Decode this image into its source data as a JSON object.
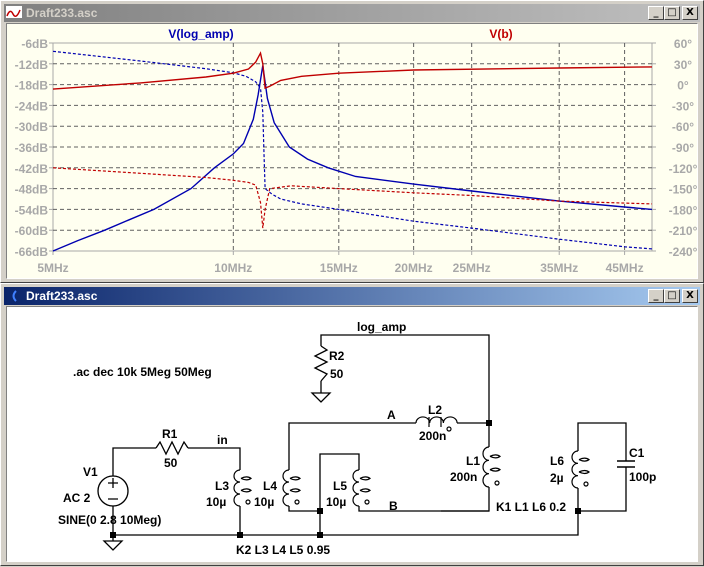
{
  "plot_window": {
    "title": "Draft233.asc",
    "buttons": {
      "minimize": "_",
      "maximize": "□",
      "close": "X"
    },
    "trace_labels": [
      {
        "label": "V(log_amp)",
        "color": "#0000b0"
      },
      {
        "label": "V(b)",
        "color": "#c00000"
      }
    ]
  },
  "chart_data": {
    "type": "line",
    "x_scale": "log",
    "xlim_mhz": [
      5,
      50
    ],
    "x_ticks": [
      "5MHz",
      "10MHz",
      "15MHz",
      "20MHz",
      "25MHz",
      "35MHz",
      "45MHz"
    ],
    "x_tick_values": [
      5,
      10,
      15,
      20,
      25,
      35,
      45
    ],
    "y_left": {
      "unit": "dB",
      "range": [
        -66,
        -6
      ],
      "ticks": [
        "-6dB",
        "-12dB",
        "-18dB",
        "-24dB",
        "-30dB",
        "-36dB",
        "-42dB",
        "-48dB",
        "-54dB",
        "-60dB",
        "-66dB"
      ]
    },
    "y_right": {
      "unit": "deg",
      "range": [
        -240,
        60
      ],
      "ticks": [
        "60°",
        "30°",
        "0°",
        "-30°",
        "-60°",
        "-90°",
        "-120°",
        "-150°",
        "-180°",
        "-210°",
        "-240°"
      ]
    },
    "grid": true,
    "series": [
      {
        "name": "V(log_amp) magnitude",
        "axis": "left",
        "style": "solid",
        "color": "#0000b0",
        "points": [
          [
            5,
            -66
          ],
          [
            5.5,
            -63
          ],
          [
            6.1,
            -60
          ],
          [
            6.7,
            -57
          ],
          [
            7.37,
            -54
          ],
          [
            8.5,
            -48
          ],
          [
            9.3,
            -42
          ],
          [
            10.0,
            -38
          ],
          [
            10.4,
            -35
          ],
          [
            10.8,
            -28
          ],
          [
            11.0,
            -21
          ],
          [
            11.2,
            -12.5
          ],
          [
            11.4,
            -22
          ],
          [
            11.7,
            -29
          ],
          [
            12.4,
            -36
          ],
          [
            13.3,
            -39.5
          ],
          [
            14.4,
            -42
          ],
          [
            16,
            -44.5
          ],
          [
            20,
            -46.7
          ],
          [
            25,
            -48.7
          ],
          [
            35,
            -51.6
          ],
          [
            45,
            -53.3
          ],
          [
            50,
            -54
          ]
        ]
      },
      {
        "name": "V(log_amp) phase",
        "axis": "right",
        "style": "dashed",
        "color": "#0000b0",
        "points": [
          [
            5,
            48
          ],
          [
            7,
            34
          ],
          [
            9,
            23
          ],
          [
            10,
            17
          ],
          [
            10.5,
            12
          ],
          [
            10.9,
            4
          ],
          [
            11.1,
            -5
          ],
          [
            11.2,
            -40
          ],
          [
            11.25,
            -100
          ],
          [
            11.3,
            -150
          ],
          [
            11.6,
            -158
          ],
          [
            12,
            -165
          ],
          [
            13,
            -172
          ],
          [
            15,
            -180
          ],
          [
            20,
            -197
          ],
          [
            25,
            -207
          ],
          [
            35,
            -223
          ],
          [
            45,
            -234
          ],
          [
            50,
            -237
          ]
        ]
      },
      {
        "name": "V(b) magnitude",
        "axis": "left",
        "style": "solid",
        "color": "#c00000",
        "points": [
          [
            5,
            -19.3
          ],
          [
            7,
            -17.5
          ],
          [
            9,
            -15.8
          ],
          [
            10,
            -14.7
          ],
          [
            10.6,
            -13.5
          ],
          [
            10.9,
            -11.5
          ],
          [
            11.1,
            -8.9
          ],
          [
            11.2,
            -12
          ],
          [
            11.3,
            -19
          ],
          [
            11.5,
            -18.5
          ],
          [
            12,
            -16.8
          ],
          [
            13,
            -15.6
          ],
          [
            15,
            -14.7
          ],
          [
            20,
            -13.8
          ],
          [
            35,
            -13.2
          ],
          [
            50,
            -12.9
          ]
        ]
      },
      {
        "name": "V(b) phase",
        "axis": "right",
        "style": "dashed",
        "color": "#c00000",
        "points": [
          [
            5,
            -120
          ],
          [
            7,
            -128
          ],
          [
            9,
            -134
          ],
          [
            10,
            -138
          ],
          [
            10.6,
            -141
          ],
          [
            10.9,
            -145
          ],
          [
            11.1,
            -170
          ],
          [
            11.2,
            -207
          ],
          [
            11.3,
            -180
          ],
          [
            11.5,
            -150
          ],
          [
            12.5,
            -146
          ],
          [
            15,
            -150
          ],
          [
            20,
            -156
          ],
          [
            25,
            -160
          ],
          [
            35,
            -168
          ],
          [
            50,
            -172
          ]
        ]
      }
    ]
  },
  "schematic_window": {
    "title": "Draft233.asc",
    "buttons": {
      "minimize": "_",
      "maximize": "□",
      "close": "X"
    },
    "directive": ".ac dec 10k 5Meg 50Meg",
    "nets": {
      "log_amp": "log_amp",
      "in": "in",
      "a": "A",
      "b": "B"
    },
    "components": {
      "V1": {
        "name": "V1",
        "value": "AC 2",
        "extra": "SINE(0 2.8 10Meg)"
      },
      "R1": {
        "name": "R1",
        "value": "50"
      },
      "R2": {
        "name": "R2",
        "value": "50"
      },
      "L1": {
        "name": "L1",
        "value": "200n"
      },
      "L2": {
        "name": "L2",
        "value": "200n"
      },
      "L3": {
        "name": "L3",
        "value": "10µ"
      },
      "L4": {
        "name": "L4",
        "value": "10µ"
      },
      "L5": {
        "name": "L5",
        "value": "10µ"
      },
      "L6": {
        "name": "L6",
        "value": "2µ"
      },
      "C1": {
        "name": "C1",
        "value": "100p"
      }
    },
    "couplings": {
      "k1": "K1 L1 L6 0.2",
      "k2": "K2 L3 L4 L5 0.95"
    }
  }
}
